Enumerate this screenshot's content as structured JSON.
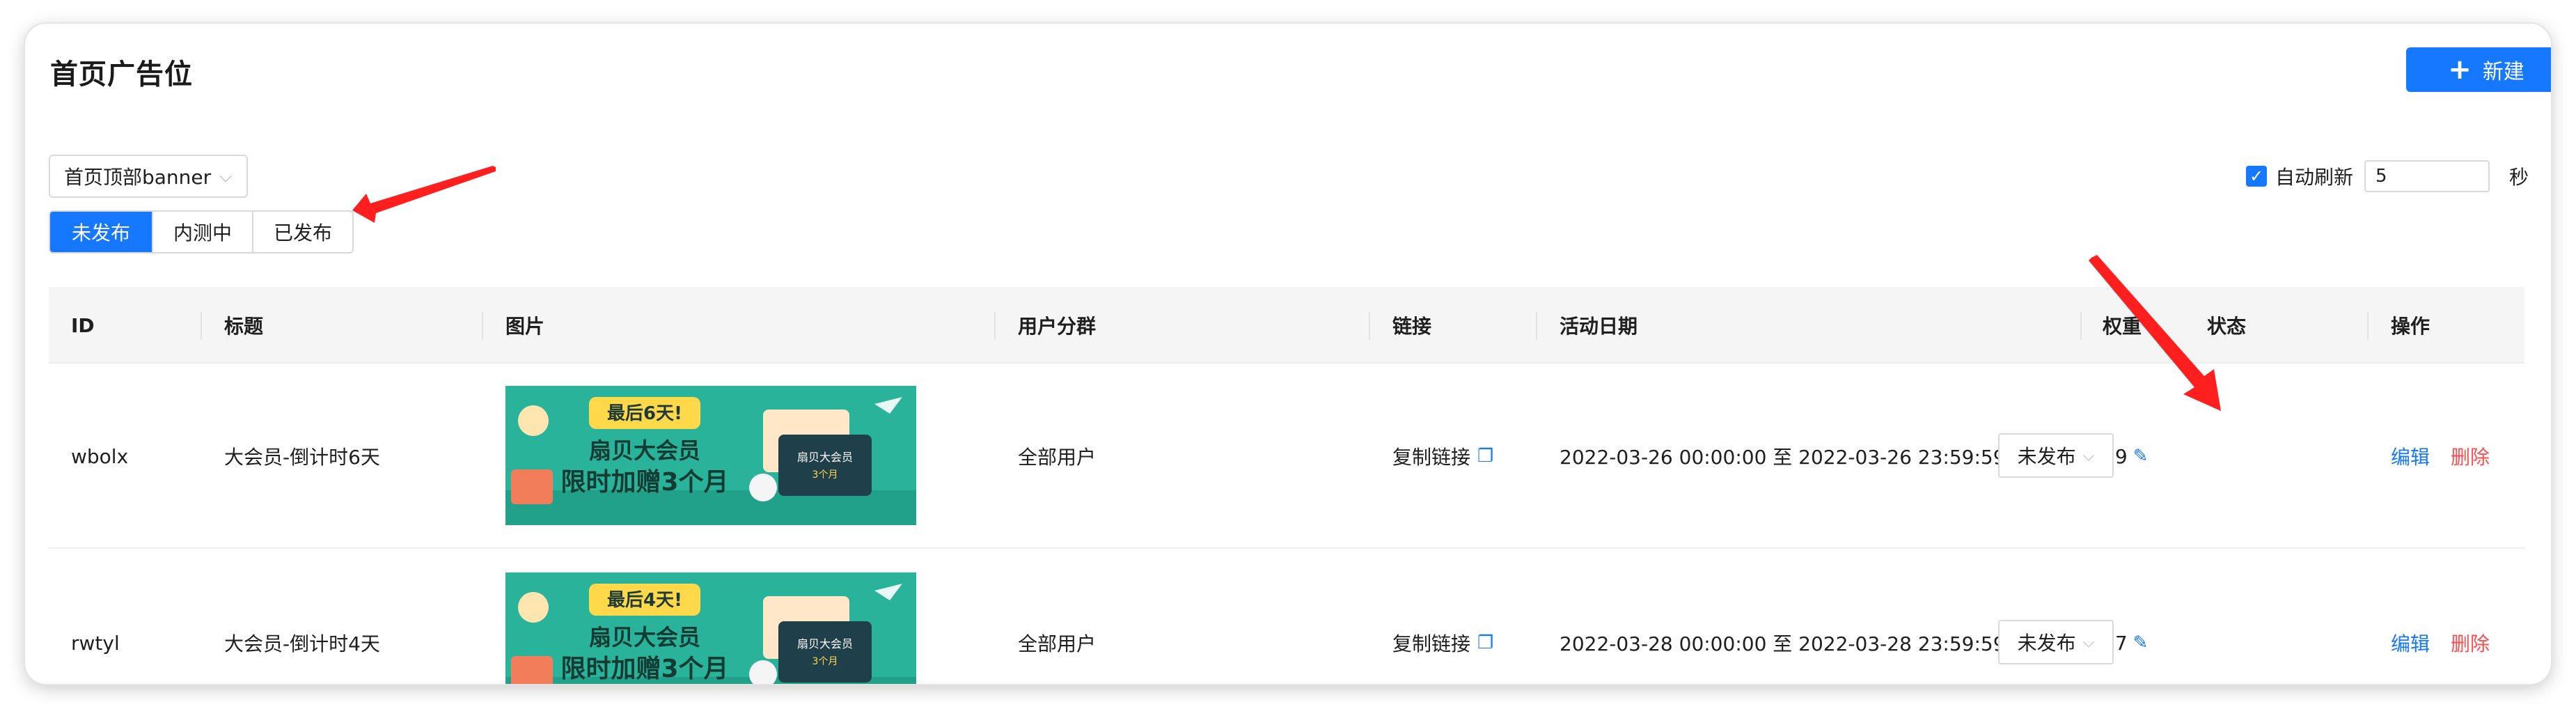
{
  "page": {
    "title": "首页广告位"
  },
  "toolbar": {
    "new_button_label": "新建",
    "new_button_icon": "plus-icon"
  },
  "filters": {
    "position_select": "首页顶部banner",
    "status_tabs": [
      {
        "label": "未发布",
        "active": true
      },
      {
        "label": "内测中",
        "active": false
      },
      {
        "label": "已发布",
        "active": false
      }
    ],
    "auto_refresh": {
      "label": "自动刷新",
      "checked": true,
      "interval_value": "5",
      "unit": "秒"
    }
  },
  "table": {
    "headers": [
      "ID",
      "标题",
      "图片",
      "用户分群",
      "链接",
      "活动日期",
      "权重",
      "状态",
      "操作"
    ],
    "rows": [
      {
        "id": "wbolx",
        "title": "大会员-倒计时6天",
        "banner": {
          "badge": "最后6天!",
          "line1": "扇贝大会员",
          "line2": "限时加赠3个月",
          "card": "扇贝大会员",
          "card_sub": "3个月"
        },
        "segment": "全部用户",
        "link": "复制链接",
        "date": "2022-03-26 00:00:00 至 2022-03-26 23:59:59",
        "weight": "39",
        "status": "未发布",
        "edit": "编辑",
        "delete": "删除"
      },
      {
        "id": "rwtyl",
        "title": "大会员-倒计时4天",
        "banner": {
          "badge": "最后4天!",
          "line1": "扇贝大会员",
          "line2": "限时加赠3个月",
          "card": "扇贝大会员",
          "card_sub": "3个月"
        },
        "segment": "全部用户",
        "link": "复制链接",
        "date": "2022-03-28 00:00:00 至 2022-03-28 23:59:59",
        "weight": "37",
        "status": "未发布",
        "edit": "编辑",
        "delete": "删除"
      }
    ]
  },
  "colors": {
    "primary": "#1677ff",
    "danger": "#ff4d4f",
    "annotation": "#ff1f1f",
    "banner_bg": "#28b39a",
    "banner_accent": "#ffd94a"
  }
}
